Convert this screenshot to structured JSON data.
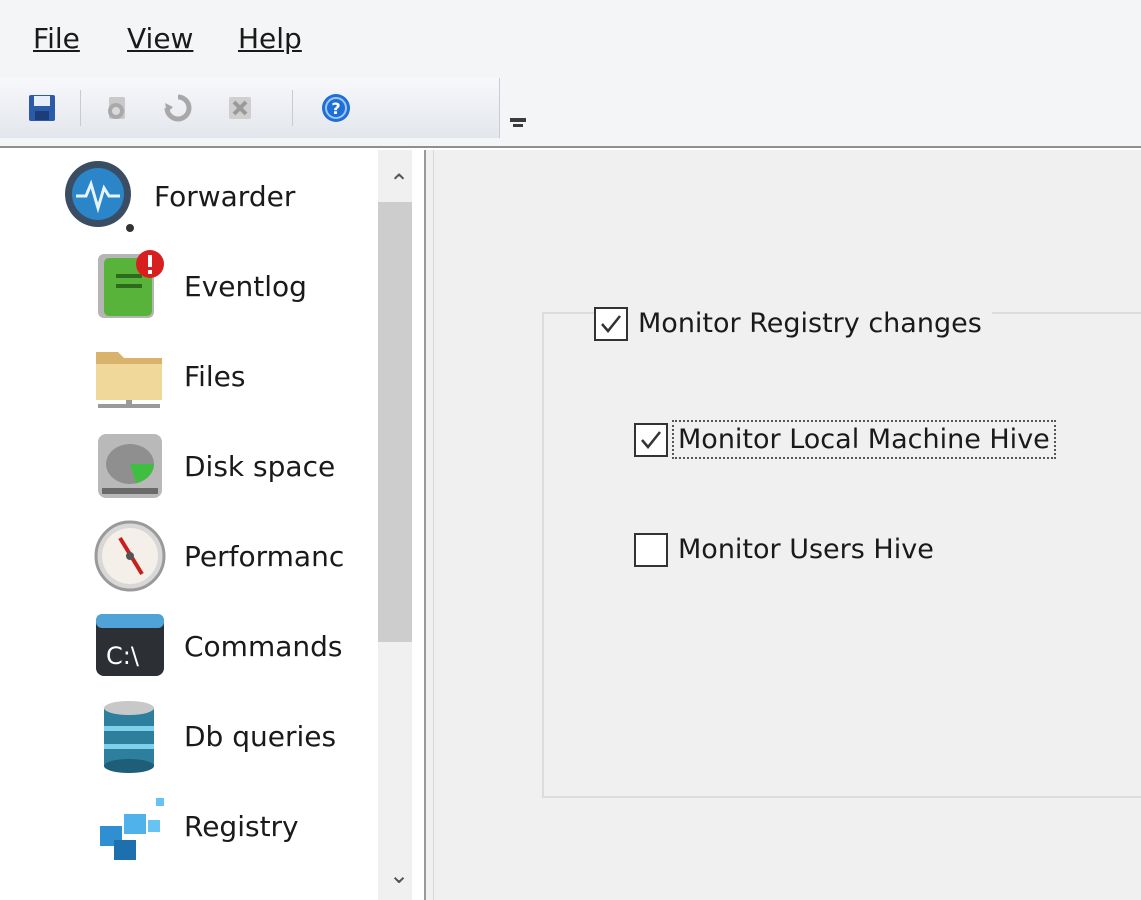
{
  "menu": {
    "file": "File",
    "view": "View",
    "help": "Help"
  },
  "toolbar": {
    "buttons": [
      "save-icon",
      "forward-icon",
      "refresh-icon",
      "delete-icon",
      "help-icon"
    ]
  },
  "sidebar": {
    "items": [
      {
        "label": "Forwarder",
        "icon": "forwarder-gauge-icon"
      },
      {
        "label": "Eventlog",
        "icon": "eventlog-book-icon"
      },
      {
        "label": "Files",
        "icon": "folder-icon"
      },
      {
        "label": "Disk space",
        "icon": "disk-drive-icon"
      },
      {
        "label": "Performanc",
        "icon": "speedometer-icon"
      },
      {
        "label": "Commands",
        "icon": "command-prompt-icon"
      },
      {
        "label": "Db queries",
        "icon": "database-icon"
      },
      {
        "label": "Registry",
        "icon": "registry-cubes-icon"
      }
    ]
  },
  "registry": {
    "monitor_changes": {
      "label": "Monitor Registry changes",
      "checked": true
    },
    "local_machine_hive": {
      "label": "Monitor Local Machine Hive",
      "checked": true
    },
    "users_hive": {
      "label": "Monitor Users Hive",
      "checked": false
    }
  },
  "colors": {
    "window_bg": "#f0f0f0",
    "help_blue": "#1f6fd6",
    "save_blue": "#2a5aa8"
  }
}
